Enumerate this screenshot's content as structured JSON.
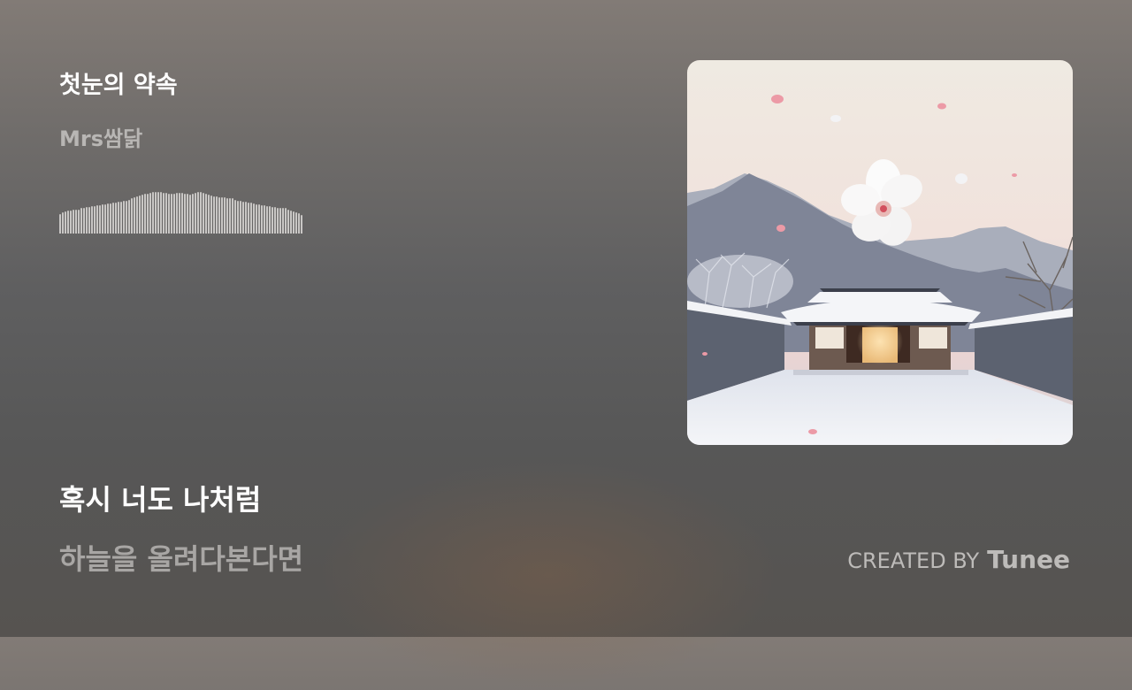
{
  "track": {
    "title": "첫눈의 약속",
    "artist": "Mrs쌈닭"
  },
  "waveform": {
    "levels": [
      0.42,
      0.46,
      0.48,
      0.5,
      0.5,
      0.52,
      0.52,
      0.52,
      0.55,
      0.55,
      0.57,
      0.57,
      0.6,
      0.6,
      0.62,
      0.62,
      0.64,
      0.64,
      0.66,
      0.66,
      0.68,
      0.68,
      0.7,
      0.7,
      0.72,
      0.72,
      0.74,
      0.76,
      0.78,
      0.8,
      0.82,
      0.84,
      0.86,
      0.86,
      0.88,
      0.9,
      0.9,
      0.9,
      0.9,
      0.88,
      0.88,
      0.86,
      0.86,
      0.86,
      0.88,
      0.88,
      0.88,
      0.86,
      0.86,
      0.84,
      0.86,
      0.88,
      0.9,
      0.9,
      0.88,
      0.86,
      0.84,
      0.82,
      0.8,
      0.8,
      0.78,
      0.78,
      0.78,
      0.76,
      0.76,
      0.76,
      0.74,
      0.72,
      0.72,
      0.7,
      0.7,
      0.68,
      0.68,
      0.66,
      0.64,
      0.64,
      0.62,
      0.62,
      0.6,
      0.6,
      0.58,
      0.58,
      0.56,
      0.55,
      0.55,
      0.55,
      0.52,
      0.5,
      0.48,
      0.46,
      0.44,
      0.4
    ],
    "color": "#c9c7c5"
  },
  "lyrics": {
    "current": "혹시 너도 나처럼",
    "next": "하늘을 올려다본다면"
  },
  "credit": {
    "prefix": "CREATED BY",
    "brand": "Tunee"
  },
  "cover": {
    "image": "album-cover-hanok-snow-flower"
  }
}
